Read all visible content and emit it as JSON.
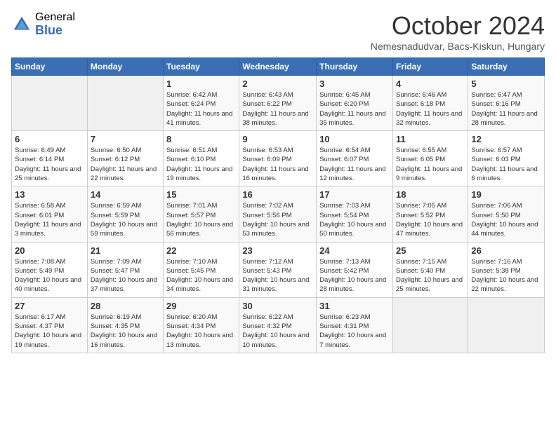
{
  "logo": {
    "general": "General",
    "blue": "Blue"
  },
  "title": "October 2024",
  "subtitle": "Nemesnadudvar, Bacs-Kiskun, Hungary",
  "days_of_week": [
    "Sunday",
    "Monday",
    "Tuesday",
    "Wednesday",
    "Thursday",
    "Friday",
    "Saturday"
  ],
  "weeks": [
    [
      {
        "day": "",
        "empty": true
      },
      {
        "day": "",
        "empty": true
      },
      {
        "day": "1",
        "sunrise": "6:42 AM",
        "sunset": "6:24 PM",
        "daylight": "11 hours and 41 minutes."
      },
      {
        "day": "2",
        "sunrise": "6:43 AM",
        "sunset": "6:22 PM",
        "daylight": "11 hours and 38 minutes."
      },
      {
        "day": "3",
        "sunrise": "6:45 AM",
        "sunset": "6:20 PM",
        "daylight": "11 hours and 35 minutes."
      },
      {
        "day": "4",
        "sunrise": "6:46 AM",
        "sunset": "6:18 PM",
        "daylight": "11 hours and 32 minutes."
      },
      {
        "day": "5",
        "sunrise": "6:47 AM",
        "sunset": "6:16 PM",
        "daylight": "11 hours and 28 minutes."
      }
    ],
    [
      {
        "day": "6",
        "sunrise": "6:49 AM",
        "sunset": "6:14 PM",
        "daylight": "11 hours and 25 minutes."
      },
      {
        "day": "7",
        "sunrise": "6:50 AM",
        "sunset": "6:12 PM",
        "daylight": "11 hours and 22 minutes."
      },
      {
        "day": "8",
        "sunrise": "6:51 AM",
        "sunset": "6:10 PM",
        "daylight": "11 hours and 19 minutes."
      },
      {
        "day": "9",
        "sunrise": "6:53 AM",
        "sunset": "6:09 PM",
        "daylight": "11 hours and 16 minutes."
      },
      {
        "day": "10",
        "sunrise": "6:54 AM",
        "sunset": "6:07 PM",
        "daylight": "11 hours and 12 minutes."
      },
      {
        "day": "11",
        "sunrise": "6:55 AM",
        "sunset": "6:05 PM",
        "daylight": "11 hours and 9 minutes."
      },
      {
        "day": "12",
        "sunrise": "6:57 AM",
        "sunset": "6:03 PM",
        "daylight": "11 hours and 6 minutes."
      }
    ],
    [
      {
        "day": "13",
        "sunrise": "6:58 AM",
        "sunset": "6:01 PM",
        "daylight": "11 hours and 3 minutes."
      },
      {
        "day": "14",
        "sunrise": "6:59 AM",
        "sunset": "5:59 PM",
        "daylight": "10 hours and 59 minutes."
      },
      {
        "day": "15",
        "sunrise": "7:01 AM",
        "sunset": "5:57 PM",
        "daylight": "10 hours and 56 minutes."
      },
      {
        "day": "16",
        "sunrise": "7:02 AM",
        "sunset": "5:56 PM",
        "daylight": "10 hours and 53 minutes."
      },
      {
        "day": "17",
        "sunrise": "7:03 AM",
        "sunset": "5:54 PM",
        "daylight": "10 hours and 50 minutes."
      },
      {
        "day": "18",
        "sunrise": "7:05 AM",
        "sunset": "5:52 PM",
        "daylight": "10 hours and 47 minutes."
      },
      {
        "day": "19",
        "sunrise": "7:06 AM",
        "sunset": "5:50 PM",
        "daylight": "10 hours and 44 minutes."
      }
    ],
    [
      {
        "day": "20",
        "sunrise": "7:08 AM",
        "sunset": "5:49 PM",
        "daylight": "10 hours and 40 minutes."
      },
      {
        "day": "21",
        "sunrise": "7:09 AM",
        "sunset": "5:47 PM",
        "daylight": "10 hours and 37 minutes."
      },
      {
        "day": "22",
        "sunrise": "7:10 AM",
        "sunset": "5:45 PM",
        "daylight": "10 hours and 34 minutes."
      },
      {
        "day": "23",
        "sunrise": "7:12 AM",
        "sunset": "5:43 PM",
        "daylight": "10 hours and 31 minutes."
      },
      {
        "day": "24",
        "sunrise": "7:13 AM",
        "sunset": "5:42 PM",
        "daylight": "10 hours and 28 minutes."
      },
      {
        "day": "25",
        "sunrise": "7:15 AM",
        "sunset": "5:40 PM",
        "daylight": "10 hours and 25 minutes."
      },
      {
        "day": "26",
        "sunrise": "7:16 AM",
        "sunset": "5:38 PM",
        "daylight": "10 hours and 22 minutes."
      }
    ],
    [
      {
        "day": "27",
        "sunrise": "6:17 AM",
        "sunset": "4:37 PM",
        "daylight": "10 hours and 19 minutes."
      },
      {
        "day": "28",
        "sunrise": "6:19 AM",
        "sunset": "4:35 PM",
        "daylight": "10 hours and 16 minutes."
      },
      {
        "day": "29",
        "sunrise": "6:20 AM",
        "sunset": "4:34 PM",
        "daylight": "10 hours and 13 minutes."
      },
      {
        "day": "30",
        "sunrise": "6:22 AM",
        "sunset": "4:32 PM",
        "daylight": "10 hours and 10 minutes."
      },
      {
        "day": "31",
        "sunrise": "6:23 AM",
        "sunset": "4:31 PM",
        "daylight": "10 hours and 7 minutes."
      },
      {
        "day": "",
        "empty": true
      },
      {
        "day": "",
        "empty": true
      }
    ]
  ]
}
